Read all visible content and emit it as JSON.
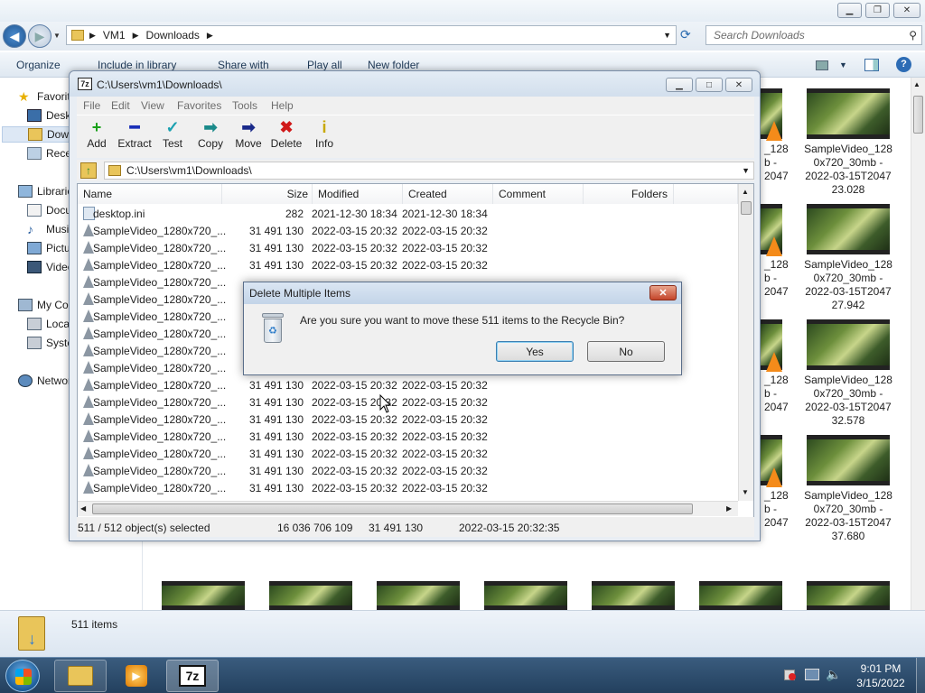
{
  "explorer": {
    "breadcrumb": [
      "VM1",
      "Downloads"
    ],
    "search_placeholder": "Search Downloads",
    "toolbar": {
      "organize": "Organize",
      "include": "Include in library",
      "share": "Share with",
      "play": "Play all",
      "new_folder": "New folder"
    },
    "nav": {
      "favorites": "Favorites",
      "desktop": "Desktop",
      "downloads": "Downloads",
      "recent": "Recent Places",
      "libraries": "Libraries",
      "documents": "Documents",
      "music": "Music",
      "pictures": "Pictures",
      "videos": "Videos",
      "computer": "My Computer",
      "local": "Local Disk (C:)",
      "system": "System Reserved",
      "network": "Network"
    },
    "thumbs_right": [
      {
        "l1": "SampleVideo_128",
        "l2": "0x720_30mb -",
        "l3": "2022-03-15T2047",
        "l4": "23.028"
      },
      {
        "l1": "SampleVideo_128",
        "l2": "0x720_30mb -",
        "l3": "2022-03-15T2047",
        "l4": "27.942"
      },
      {
        "l1": "SampleVideo_128",
        "l2": "0x720_30mb -",
        "l3": "2022-03-15T2047",
        "l4": "32.578"
      },
      {
        "l1": "SampleVideo_128",
        "l2": "0x720_30mb -",
        "l3": "2022-03-15T2047",
        "l4": "37.680"
      }
    ],
    "partial_caps": [
      {
        "a": "_128",
        "b": "b -",
        "c": "2047"
      },
      {
        "a": "_128",
        "b": "b -",
        "c": "2047"
      },
      {
        "a": "_128",
        "b": "b -",
        "c": "2047"
      },
      {
        "a": "_128",
        "b": "b -",
        "c": "2047"
      }
    ],
    "status": "511 items"
  },
  "zip": {
    "title": "C:\\Users\\vm1\\Downloads\\",
    "menu": [
      "File",
      "Edit",
      "View",
      "Favorites",
      "Tools",
      "Help"
    ],
    "tools": [
      {
        "label": "Add",
        "icon": "+",
        "color": "#1aa01a"
      },
      {
        "label": "Extract",
        "icon": "━",
        "color": "#1a2fb8"
      },
      {
        "label": "Test",
        "icon": "✓",
        "color": "#1aa0b0"
      },
      {
        "label": "Copy",
        "icon": "➡",
        "color": "#1a8a8a"
      },
      {
        "label": "Move",
        "icon": "➡",
        "color": "#1a2a8a"
      },
      {
        "label": "Delete",
        "icon": "✖",
        "color": "#d01818"
      },
      {
        "label": "Info",
        "icon": "i",
        "color": "#c8a800"
      }
    ],
    "path": "C:\\Users\\vm1\\Downloads\\",
    "columns": {
      "name": "Name",
      "size": "Size",
      "modified": "Modified",
      "created": "Created",
      "comment": "Comment",
      "folders": "Folders"
    },
    "rows": [
      {
        "name": "desktop.ini",
        "size": "282",
        "modified": "2021-12-30 18:34",
        "created": "2021-12-30 18:34"
      },
      {
        "name": "SampleVideo_1280x720_...",
        "size": "31 491 130",
        "modified": "2022-03-15 20:32",
        "created": "2022-03-15 20:32"
      },
      {
        "name": "SampleVideo_1280x720_...",
        "size": "31 491 130",
        "modified": "2022-03-15 20:32",
        "created": "2022-03-15 20:32"
      },
      {
        "name": "SampleVideo_1280x720_...",
        "size": "31 491 130",
        "modified": "2022-03-15 20:32",
        "created": "2022-03-15 20:32"
      },
      {
        "name": "SampleVideo_1280x720_...",
        "size": "",
        "modified": "",
        "created": ""
      },
      {
        "name": "SampleVideo_1280x720_...",
        "size": "",
        "modified": "",
        "created": ""
      },
      {
        "name": "SampleVideo_1280x720_...",
        "size": "",
        "modified": "",
        "created": ""
      },
      {
        "name": "SampleVideo_1280x720_...",
        "size": "",
        "modified": "",
        "created": ""
      },
      {
        "name": "SampleVideo_1280x720_...",
        "size": "",
        "modified": "",
        "created": ""
      },
      {
        "name": "SampleVideo_1280x720_...",
        "size": "",
        "modified": "",
        "created": ""
      },
      {
        "name": "SampleVideo_1280x720_...",
        "size": "31 491 130",
        "modified": "2022-03-15 20:32",
        "created": "2022-03-15 20:32"
      },
      {
        "name": "SampleVideo_1280x720_...",
        "size": "31 491 130",
        "modified": "2022-03-15 20:32",
        "created": "2022-03-15 20:32"
      },
      {
        "name": "SampleVideo_1280x720_...",
        "size": "31 491 130",
        "modified": "2022-03-15 20:32",
        "created": "2022-03-15 20:32"
      },
      {
        "name": "SampleVideo_1280x720_...",
        "size": "31 491 130",
        "modified": "2022-03-15 20:32",
        "created": "2022-03-15 20:32"
      },
      {
        "name": "SampleVideo_1280x720_...",
        "size": "31 491 130",
        "modified": "2022-03-15 20:32",
        "created": "2022-03-15 20:32"
      },
      {
        "name": "SampleVideo_1280x720_...",
        "size": "31 491 130",
        "modified": "2022-03-15 20:32",
        "created": "2022-03-15 20:32"
      },
      {
        "name": "SampleVideo_1280x720_...",
        "size": "31 491 130",
        "modified": "2022-03-15 20:32",
        "created": "2022-03-15 20:32"
      }
    ],
    "status": {
      "selected": "511 / 512 object(s) selected",
      "total_size": "16 036 706 109",
      "item_size": "31 491 130",
      "date": "2022-03-15 20:32:35"
    }
  },
  "dialog": {
    "title": "Delete Multiple Items",
    "message": "Are you sure you want to move these 511 items to the Recycle Bin?",
    "yes": "Yes",
    "no": "No",
    "close": "✕"
  },
  "taskbar": {
    "time": "9:01 PM",
    "date": "3/15/2022",
    "app_7z": "7z"
  }
}
